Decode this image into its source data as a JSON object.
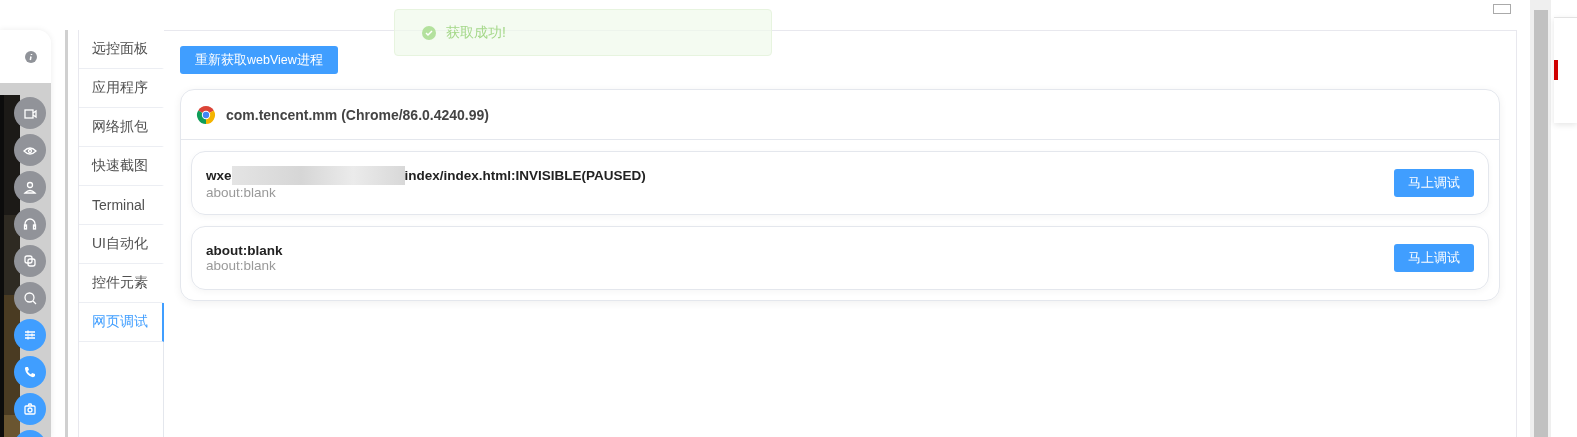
{
  "toast": {
    "text": "获取成功!"
  },
  "side_buttons": [
    {
      "on": false
    },
    {
      "on": false
    },
    {
      "on": false
    },
    {
      "on": false
    },
    {
      "on": false
    },
    {
      "on": false
    },
    {
      "on": true
    },
    {
      "on": true
    },
    {
      "on": true
    },
    {
      "on": true
    }
  ],
  "tabs": [
    {
      "label": "远控面板",
      "selected": false
    },
    {
      "label": "应用程序",
      "selected": false
    },
    {
      "label": "网络抓包",
      "selected": false
    },
    {
      "label": "快速截图",
      "selected": false
    },
    {
      "label": "Terminal",
      "selected": false
    },
    {
      "label": "UI自动化",
      "selected": false
    },
    {
      "label": "控件元素",
      "selected": false
    },
    {
      "label": "网页调试",
      "selected": true
    }
  ],
  "refresh_button": "重新获取webView进程",
  "process": {
    "title": "com.tencent.mm (Chrome/86.0.4240.99)",
    "pages": [
      {
        "title_start": "wxe",
        "redacted": true,
        "title_end": "index/index.html:INVISIBLE(PAUSED)",
        "url": "about:blank",
        "button": "马上调试"
      },
      {
        "title_start": "about:blank",
        "redacted": false,
        "url": "about:blank",
        "button": "马上调试"
      }
    ]
  }
}
